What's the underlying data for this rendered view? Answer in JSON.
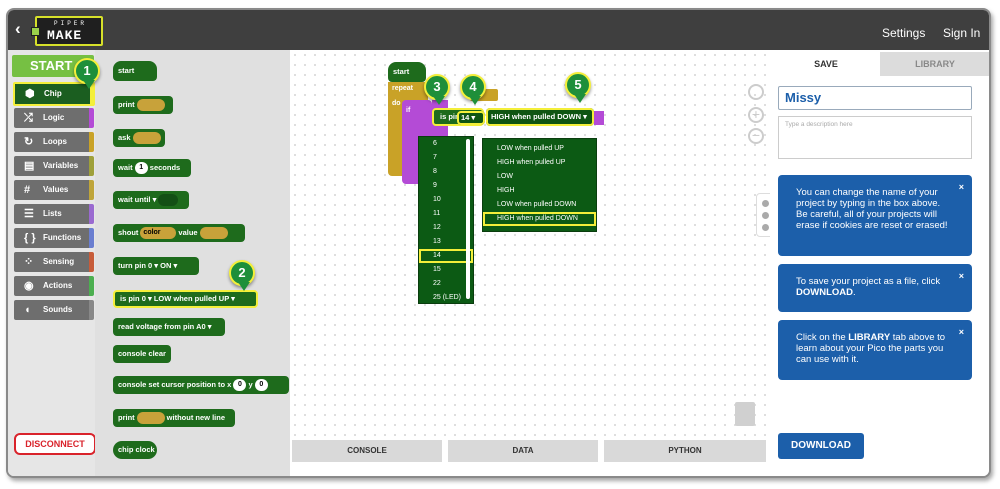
{
  "topbar": {
    "back": "‹",
    "logo_top": "PIPER",
    "logo_main": "MAKE",
    "settings": "Settings",
    "signin": "Sign In"
  },
  "sidebar": {
    "start": "START",
    "items": [
      {
        "label": "Chip",
        "icon": "⬢",
        "color": "#76c043"
      },
      {
        "label": "Logic",
        "icon": "⤮",
        "color": "#b44bd6"
      },
      {
        "label": "Loops",
        "icon": "↻",
        "color": "#c9a227"
      },
      {
        "label": "Variables",
        "icon": "▤",
        "color": "#9fa03a"
      },
      {
        "label": "Values",
        "icon": "#",
        "color": "#bfa53a"
      },
      {
        "label": "Lists",
        "icon": "☰",
        "color": "#9a6ad0"
      },
      {
        "label": "Functions",
        "icon": "{ }",
        "color": "#6a7ed0"
      },
      {
        "label": "Sensing",
        "icon": "⁘",
        "color": "#c75c3a"
      },
      {
        "label": "Actions",
        "icon": "◉",
        "color": "#4caf50"
      },
      {
        "label": "Sounds",
        "icon": "◖",
        "color": "#888888"
      }
    ],
    "disconnect": "DISCONNECT"
  },
  "flyout": {
    "start": "start",
    "print": "print",
    "ask": "ask",
    "wait": "wait",
    "wait_val": "1",
    "seconds": "seconds",
    "wait_until": "wait until ▾",
    "shout": "shout",
    "color": "color",
    "value": "value",
    "turn_pin": "turn pin",
    "pin0": "0 ▾",
    "on": "ON ▾",
    "is_pin": "is pin",
    "low_pulled_up": "LOW when pulled UP ▾",
    "read_voltage": "read voltage from pin",
    "a0": "A0 ▾",
    "console_clear": "console clear",
    "cursor": "console set cursor position to x",
    "x0": "0",
    "y": "y",
    "y0": "0",
    "print2": "print",
    "without_new_line": "without new line",
    "chip_clock": "chip clock",
    "quote": "❝ ❞"
  },
  "workspace": {
    "start": "start",
    "repeat": "repeat",
    "do": "do",
    "if": "if",
    "is_pin": "is pin",
    "pin_value": "14 ▾",
    "high_pulled_down": "HIGH when pulled DOWN ▾",
    "pin_options": [
      "6",
      "7",
      "8",
      "9",
      "10",
      "11",
      "12",
      "13",
      "14",
      "15",
      "22",
      "25 (LED)"
    ],
    "state_options": [
      "LOW when pulled UP",
      "HIGH when pulled UP",
      "LOW",
      "HIGH",
      "LOW when pulled DOWN",
      "HIGH when pulled DOWN"
    ]
  },
  "badges": [
    "1",
    "2",
    "3",
    "4",
    "5"
  ],
  "bottom_tabs": [
    "CONSOLE",
    "DATA",
    "PYTHON"
  ],
  "right": {
    "tab_save": "SAVE",
    "tab_library": "LIBRARY",
    "name_value": "Missy",
    "desc_placeholder": "Type a description here",
    "tip1": "You can change the name of your project by typing in the box above. Be careful, all of your projects will erase if cookies are reset or erased!",
    "tip2_pre": "To save your project as a file, click ",
    "tip2_bold": "DOWNLOAD",
    "tip2_post": ".",
    "tip3_pre": "Click on the ",
    "tip3_bold": "LIBRARY",
    "tip3_post": " tab above to learn about your Pico the parts you can use with it.",
    "close": "×",
    "download": "DOWNLOAD"
  },
  "colors": {
    "topbar": "#3f3f3f",
    "block_green": "#1e6b1c",
    "accent_yellow": "#f4ef3a",
    "blue": "#1c5faa",
    "logic_purple": "#b44bd6"
  }
}
